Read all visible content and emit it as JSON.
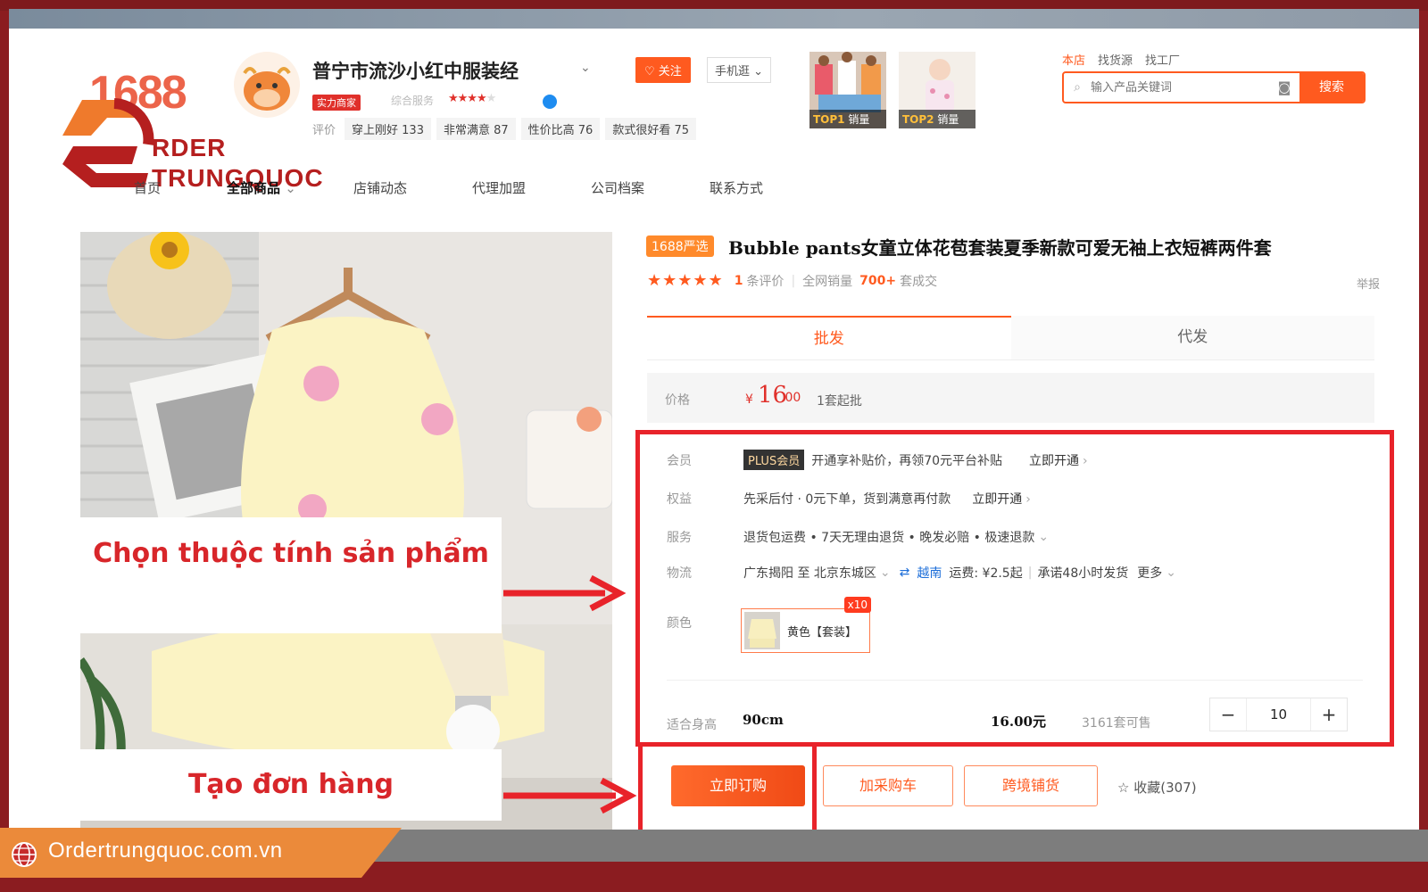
{
  "logo": {
    "n1688": "1688",
    "line1": "RDER",
    "line2": "TRUNGQUOC"
  },
  "shop": {
    "name": "普宁市流沙小红中服装经",
    "strength_badge": "实力商家",
    "service_label": "综合服务",
    "rating_label": "评价",
    "ratings": [
      "穿上刚好 133",
      "非常满意 87",
      "性价比高 76",
      "款式很好看 75"
    ],
    "follow": "♡ 关注",
    "mobile": "手机逛 ⌄",
    "top1": {
      "rank": "TOP1",
      "label": "销量"
    },
    "top2": {
      "rank": "TOP2",
      "label": "销量"
    }
  },
  "search": {
    "tabs": [
      "本店",
      "找货源",
      "找工厂"
    ],
    "placeholder": "输入产品关键词",
    "button": "搜索"
  },
  "nav": [
    "首页",
    "全部商品",
    "店铺动态",
    "代理加盟",
    "公司档案",
    "联系方式"
  ],
  "product": {
    "badge": "1688严选",
    "title": "Bubble pants女童立体花苞套装夏季新款可爱无袖上衣短裤两件套",
    "stars": "★★★★★",
    "review_count": "1",
    "review_text": "条评价",
    "sales_label": "全网销量",
    "sales_value": "700+",
    "sales_suffix": "套成交",
    "report": "举报",
    "tabs": [
      "批发",
      "代发"
    ],
    "price_label": "价格",
    "currency": "¥",
    "price_int": "16",
    "price_dec": ".00",
    "moq": "1套起批",
    "member_label": "会员",
    "plus_badge": "PLUS会员",
    "member_text": "开通享补贴价，再领70元平台补贴",
    "member_link": "立即开通",
    "benefit_label": "权益",
    "benefit_text": "先采后付 · 0元下单，货到满意再付款",
    "benefit_link": "立即开通",
    "service_label": "服务",
    "service_text": "退货包运费 • 7天无理由退货 • 晚发必赔 • 极速退款",
    "logistics_label": "物流",
    "logistics_from": "广东揭阳 至 北京东城区",
    "logistics_dest": "越南",
    "logistics_fee": "运费: ¥2.5起",
    "logistics_promise": "承诺48小时发货",
    "logistics_more": "更多",
    "color_label": "颜色",
    "color_option": "黄色【套装】",
    "color_qty": "x10",
    "height_label": "适合身高",
    "height_value": "90cm",
    "unit_price": "16.00元",
    "stock": "3161套可售",
    "qty": "10",
    "buy_now": "立即订购",
    "add_cart": "加采购车",
    "cross_border": "跨境铺货",
    "favorite": "收藏(307)"
  },
  "annotations": {
    "callout1": "Chọn thuộc tính sản phẩm",
    "callout2": "Tạo đơn hàng"
  },
  "footer": {
    "site": "Ordertrungquoc.com.vn"
  },
  "colors": {
    "accent": "#ff5a1f",
    "annotation_red": "#e8232a",
    "frame": "#8b1c20",
    "banner": "#eb8a3a"
  }
}
